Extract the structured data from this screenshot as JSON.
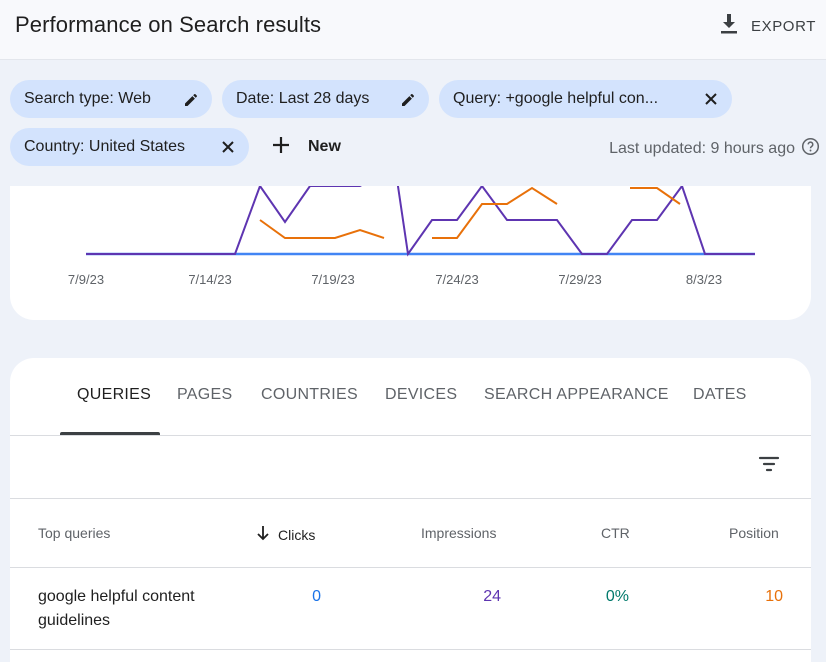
{
  "header": {
    "title": "Performance on Search results",
    "export_label": "EXPORT"
  },
  "filters": {
    "search_type": "Search type: Web",
    "date": "Date: Last 28 days",
    "query": "Query: +google helpful con...",
    "country": "Country: United States",
    "new_label": "New",
    "last_updated": "Last updated: 9 hours ago"
  },
  "chart_data": {
    "type": "line",
    "x_tick_labels": [
      "7/9/23",
      "7/14/23",
      "7/19/23",
      "7/24/23",
      "7/29/23",
      "8/3/23"
    ],
    "series_colors": {
      "clicks": "#4285f4",
      "impressions": "#5e35b1",
      "position": "#e8710a"
    },
    "grid": false,
    "legend": "none",
    "note_visible_region": "upper portion of chart is scrolled out of view"
  },
  "tabs": [
    {
      "label": "QUERIES",
      "active": true
    },
    {
      "label": "PAGES",
      "active": false
    },
    {
      "label": "COUNTRIES",
      "active": false
    },
    {
      "label": "DEVICES",
      "active": false
    },
    {
      "label": "SEARCH APPEARANCE",
      "active": false
    },
    {
      "label": "DATES",
      "active": false
    }
  ],
  "table": {
    "columns": {
      "query": "Top queries",
      "clicks": "Clicks",
      "impressions": "Impressions",
      "ctr": "CTR",
      "position": "Position"
    },
    "rows": [
      {
        "query": "google helpful content guidelines",
        "clicks": "0",
        "impressions": "24",
        "ctr": "0%",
        "position": "10"
      }
    ]
  },
  "colors": {
    "clicks": "#1a73e8",
    "impressions": "#5e35b1",
    "ctr": "#00796b",
    "position": "#e8710a",
    "chip_bg": "#d3e3fd"
  }
}
